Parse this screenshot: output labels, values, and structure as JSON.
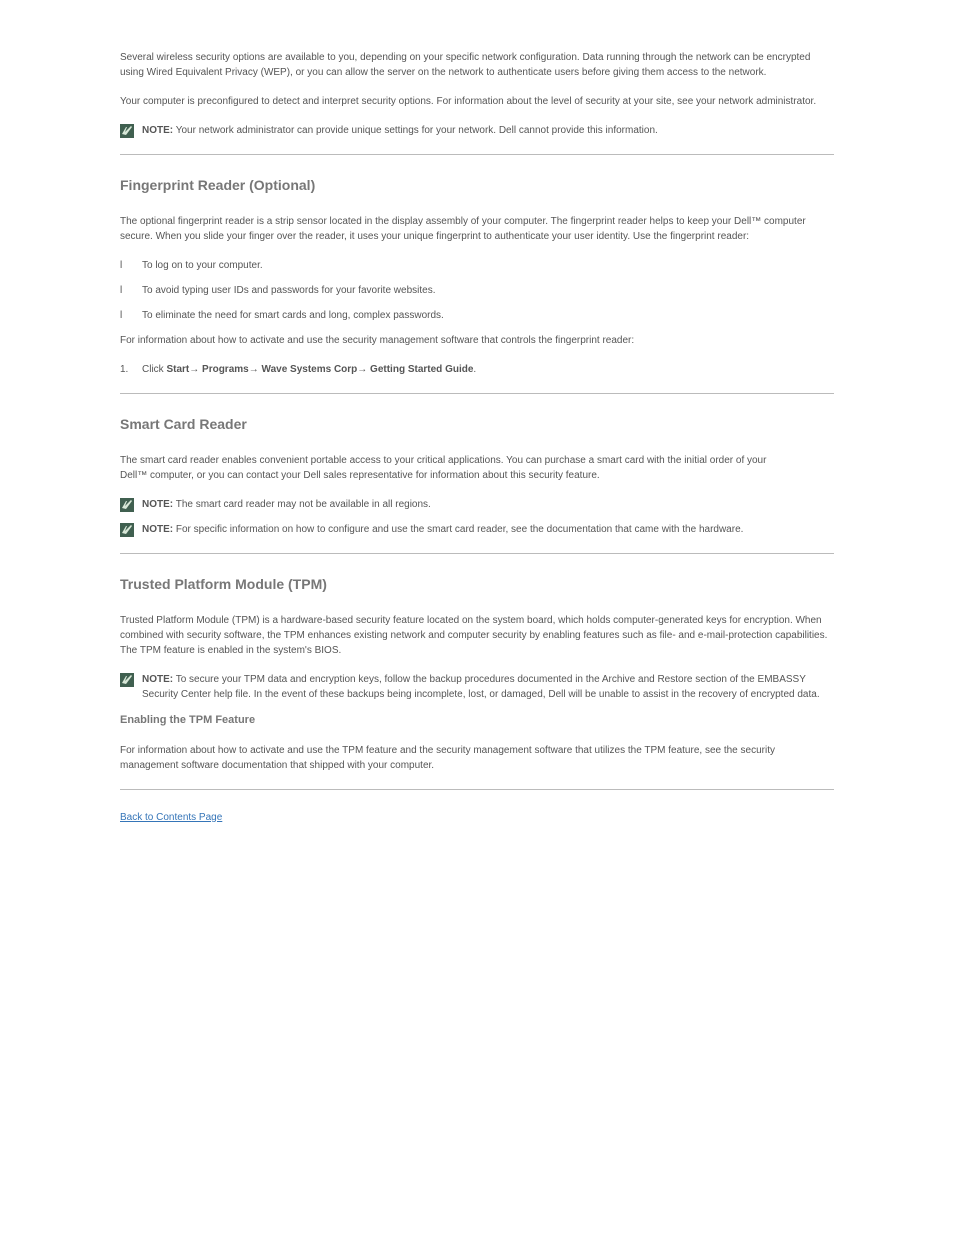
{
  "intro": {
    "p1": "Several wireless security options are available to you, depending on your specific network configuration. Data running through the network can be encrypted using Wired Equivalent Privacy (WEP), or you can allow the server on the network to authenticate users before giving them access to the network.",
    "p2": "Your computer is preconfigured to detect and interpret security options. For information about the level of security at your site, see your network administrator."
  },
  "noteIntro": {
    "label": "NOTE:",
    "text": " Your network administrator can provide unique settings for your network. Dell cannot provide this information."
  },
  "fingerprint": {
    "heading": "Fingerprint Reader (Optional)",
    "p1": "The optional fingerprint reader is a strip sensor located in the display assembly of your computer. The fingerprint reader helps to keep your Dell™ computer secure. When you slide your finger over the reader, it uses your unique fingerprint to authenticate your user identity. Use the fingerprint reader:",
    "bullet1": "To log on to your computer.",
    "bullet2": "To avoid typing user IDs and passwords for your favorite websites.",
    "bullet3": "To eliminate the need for smart cards and long, complex passwords.",
    "p2": "For information about how to activate and use the security management software that controls the fingerprint reader:",
    "step1_pre": "Click ",
    "step1_start": "Start",
    "step1_programs": " Programs",
    "step1_wave": " Wave Systems Corp",
    "step1_gsg": " Getting Started Guide",
    "step1_after": ".",
    "arrow": "→"
  },
  "smartcard": {
    "heading": "Smart Card Reader",
    "p1a": "The smart card reader enables convenient portable access to your critical applications. You can purchase a smart card with the initial order of your ",
    "p1b": "Dell™ computer, or you can contact your Dell sales representative for information about this security feature.",
    "note1": {
      "label": "NOTE:",
      "text": " The smart card reader may not be available in all regions."
    },
    "note2": {
      "label": "NOTE:",
      "text": " For specific information on how to configure and use the smart card reader, see the documentation that came with the hardware."
    }
  },
  "tpm": {
    "heading": "Trusted Platform Module (TPM)",
    "p1": "Trusted Platform Module (TPM) is a hardware-based security feature located on the system board, which holds computer-generated keys for encryption. When combined with security software, the TPM enhances existing network and computer security by enabling features such as file- and e-mail-protection capabilities. The TPM feature is enabled in the system's BIOS.",
    "note": {
      "label": "NOTE:",
      "text": " To secure your TPM data and encryption keys, follow the backup procedures documented in the Archive and Restore section of the EMBASSY Security Center help file. In the event of these backups being incomplete, lost, or damaged, Dell will be unable to assist in the recovery of encrypted data."
    },
    "subheading": "Enabling the TPM Feature",
    "p2": "For information about how to activate and use the TPM feature and the security management software that utilizes the TPM feature, see the security management software documentation that shipped with your computer."
  },
  "back": "Back to Contents Page"
}
